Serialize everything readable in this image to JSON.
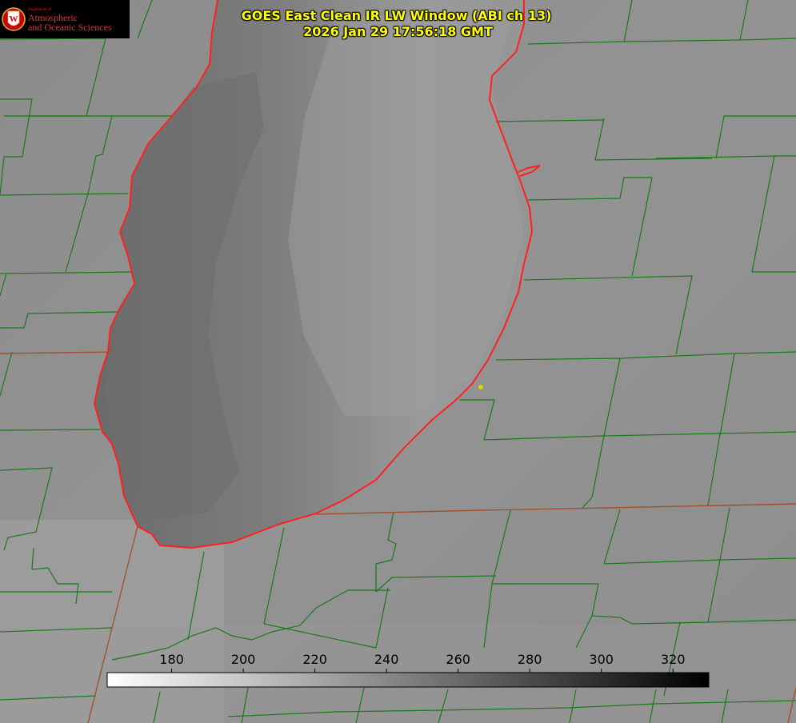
{
  "logo": {
    "department": "Department of",
    "line1": "Atmospheric",
    "line2": "and Oceanic Sciences",
    "seal_letter": "W"
  },
  "title": {
    "line1": "GOES East Clean IR LW Window (ABI ch 13)",
    "line2": "2026 Jan 29 17:56:18 GMT"
  },
  "colorbar": {
    "min": 162,
    "max": 330,
    "ticks": [
      180,
      200,
      220,
      240,
      260,
      280,
      300,
      320
    ],
    "low_color": "#ffffff",
    "high_color": "#000000"
  },
  "colors": {
    "county_lines": "#1a7a1a",
    "lake_outline": "#ff2020",
    "state_lines": "#a0522d",
    "title_text": "#ffff00",
    "point_marker": "#e0d000"
  }
}
